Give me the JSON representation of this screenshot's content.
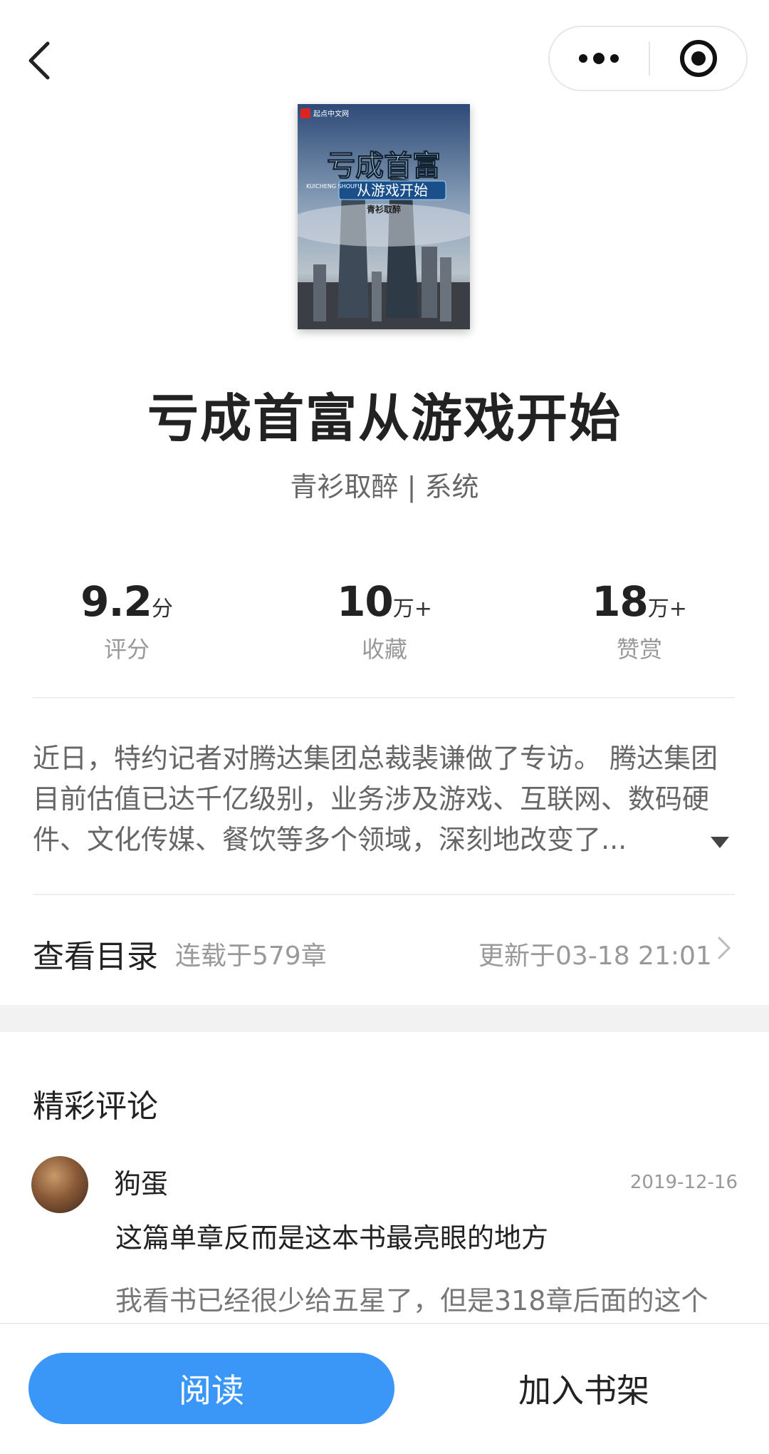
{
  "topbar": {
    "back_icon": "chevron-left-icon",
    "more_icon": "more-dots-icon",
    "target_icon": "target-icon"
  },
  "book": {
    "cover": {
      "brand_text": "起点中文网",
      "title_main": "亏成首富",
      "title_sub": "从游戏开始",
      "latin_text": "KUICHENG SHOUFU",
      "author_stamp": "青衫取醉"
    },
    "title": "亏成首富从游戏开始",
    "meta": "青衫取醉 | 系统"
  },
  "stats": [
    {
      "value": "9.2",
      "unit": "分",
      "label": "评分"
    },
    {
      "value": "10",
      "unit": "万+",
      "label": "收藏"
    },
    {
      "value": "18",
      "unit": "万+",
      "label": "赞赏"
    }
  ],
  "description": {
    "text": "近日，特约记者对腾达集团总裁裴谦做了专访。 腾达集团目前估值已达千亿级别，业务涉及游戏、互联网、数码硬件、文化传媒、餐饮等多个领域，深刻地改变了...",
    "expand_icon": "caret-down-icon"
  },
  "toc": {
    "title": "查看目录",
    "count": "连载于579章",
    "update": "更新于03-18 21:01",
    "chevron_icon": "chevron-right-icon"
  },
  "comments": {
    "section_title": "精彩评论",
    "items": [
      {
        "user": "狗蛋",
        "date": "2019-12-16",
        "title": "这篇单章反而是这本书最亮眼的地方",
        "body": "我看书已经很少给五星了，但是318章后面的这个"
      }
    ]
  },
  "actions": {
    "read_label": "阅读",
    "shelf_label": "加入书架"
  },
  "colors": {
    "accent": "#3a97f7",
    "text_primary": "#222222",
    "text_secondary": "#999999"
  }
}
